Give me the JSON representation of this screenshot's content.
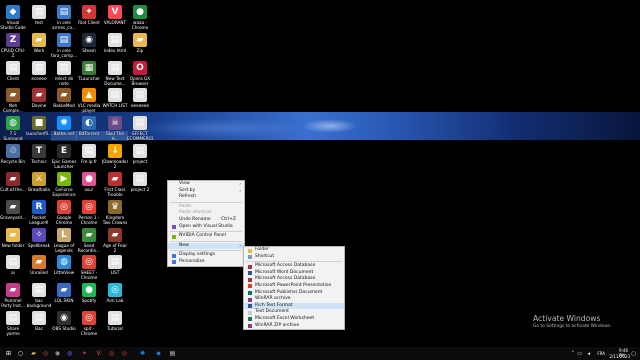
{
  "desktop": {
    "icons": [
      {
        "label": "Visual Studio Code",
        "glyph": "◆",
        "color": "#2b7acb",
        "col": 0,
        "row": 0
      },
      {
        "label": "test",
        "glyph": "▤",
        "color": "#e0e0e0",
        "col": 1,
        "row": 0
      },
      {
        "label": "in cele armes_co...",
        "glyph": "▤",
        "color": "#3c78c8",
        "col": 2,
        "row": 0
      },
      {
        "label": "Riot Client",
        "glyph": "✦",
        "color": "#d13639",
        "col": 3,
        "row": 0
      },
      {
        "label": "VALORANT",
        "glyph": "V",
        "color": "#ff4655",
        "col": 4,
        "row": 0
      },
      {
        "label": "waaa - Chrome",
        "glyph": "●",
        "color": "#1e8e3e",
        "col": 5,
        "row": 0
      },
      {
        "label": "CPUID CPU-Z",
        "glyph": "Z",
        "color": "#5a3c91",
        "col": 0,
        "row": 1
      },
      {
        "label": "Work",
        "glyph": "▰",
        "color": "#e8b84b",
        "col": 1,
        "row": 1
      },
      {
        "label": "in cele fara_comp...",
        "glyph": "▤",
        "color": "#3c78c8",
        "col": 2,
        "row": 1
      },
      {
        "label": "Steam",
        "glyph": "◉",
        "color": "#1b2838",
        "col": 3,
        "row": 1
      },
      {
        "label": "index.html",
        "glyph": "▤",
        "color": "#e0e0e0",
        "col": 4,
        "row": 1
      },
      {
        "label": "Zip",
        "glyph": "▰",
        "color": "#e8b84b",
        "col": 5,
        "row": 1
      },
      {
        "label": "Client",
        "glyph": "▤",
        "color": "#e0e0e0",
        "col": 0,
        "row": 2
      },
      {
        "label": "eceeeo",
        "glyph": "▤",
        "color": "#e0e0e0",
        "col": 1,
        "row": 2
      },
      {
        "label": "relect de note",
        "glyph": "▤",
        "color": "#e0e0e0",
        "col": 2,
        "row": 2
      },
      {
        "label": "TLauncher",
        "glyph": "▦",
        "color": "#3a7b3a",
        "col": 3,
        "row": 2
      },
      {
        "label": "New Text Docume...",
        "glyph": "▤",
        "color": "#e0e0e0",
        "col": 4,
        "row": 2
      },
      {
        "label": "Opera GX Browser",
        "glyph": "O",
        "color": "#c41a3b",
        "col": 5,
        "row": 2
      },
      {
        "label": "Noh Comple...",
        "glyph": "▰",
        "color": "#8a5a2b",
        "col": 0,
        "row": 3
      },
      {
        "label": "Devine",
        "glyph": "▰",
        "color": "#a03232",
        "col": 1,
        "row": 3
      },
      {
        "label": "BakkeMod",
        "glyph": "▰",
        "color": "#8a5a2b",
        "col": 2,
        "row": 3
      },
      {
        "label": "VLC media player",
        "glyph": "▲",
        "color": "#f08a00",
        "col": 3,
        "row": 3
      },
      {
        "label": "WATCH LIST",
        "glyph": "▤",
        "color": "#e0e0e0",
        "col": 4,
        "row": 3
      },
      {
        "label": "eeeeeee",
        "glyph": "▤",
        "color": "#e0e0e0",
        "col": 5,
        "row": 3
      },
      {
        "label": "7.1 Surround Sound",
        "glyph": "◍",
        "color": "#2ea04a",
        "col": 0,
        "row": 4
      },
      {
        "label": "launcherfil...",
        "glyph": "■",
        "color": "#6b6b2b",
        "col": 1,
        "row": 4
      },
      {
        "label": "Battle.net",
        "glyph": "✺",
        "color": "#148eff",
        "col": 2,
        "row": 4
      },
      {
        "label": "BitTorrent",
        "glyph": "◐",
        "color": "#2a6ab3",
        "col": 3,
        "row": 4
      },
      {
        "label": "Skul The H...",
        "glyph": "☠",
        "color": "#6a4a8a",
        "col": 4,
        "row": 4
      },
      {
        "label": "EFFECT ECOMMERCE",
        "glyph": "▤",
        "color": "#e0e0e0",
        "col": 5,
        "row": 4
      },
      {
        "label": "Recycle Bin",
        "glyph": "♲",
        "color": "#4a6fa5",
        "col": 0,
        "row": 5
      },
      {
        "label": "Technic",
        "glyph": "T",
        "color": "#3a3a3a",
        "col": 1,
        "row": 5
      },
      {
        "label": "Epic Games Launcher",
        "glyph": "E",
        "color": "#2a2a2a",
        "col": 2,
        "row": 5
      },
      {
        "label": "Fre:ip fr",
        "glyph": "▤",
        "color": "#e0e0e0",
        "col": 3,
        "row": 5
      },
      {
        "label": "JDownloader 2",
        "glyph": "↓",
        "color": "#f4a400",
        "col": 4,
        "row": 5
      },
      {
        "label": "project",
        "glyph": "▤",
        "color": "#e0e0e0",
        "col": 5,
        "row": 5
      },
      {
        "label": "Cult.of.the...",
        "glyph": "▰",
        "color": "#8a2b2b",
        "col": 0,
        "row": 6
      },
      {
        "label": "Brawlhalla",
        "glyph": "⚔",
        "color": "#c8a02b",
        "col": 1,
        "row": 6
      },
      {
        "label": "GeForce Experience",
        "glyph": "▶",
        "color": "#76b900",
        "col": 2,
        "row": 6
      },
      {
        "label": "osu!",
        "glyph": "●",
        "color": "#e05398",
        "col": 3,
        "row": 6
      },
      {
        "label": "First Class Trouble",
        "glyph": "▰",
        "color": "#b83232",
        "col": 4,
        "row": 6
      },
      {
        "label": "project 2",
        "glyph": "▤",
        "color": "#e0e0e0",
        "col": 5,
        "row": 6
      },
      {
        "label": "Graveyard...",
        "glyph": "▰",
        "color": "#4a4a4a",
        "col": 0,
        "row": 7
      },
      {
        "label": "Rocket League®",
        "glyph": "R",
        "color": "#1e5ac8",
        "col": 1,
        "row": 7
      },
      {
        "label": "Google Chrome",
        "glyph": "◎",
        "color": "#db4437",
        "col": 2,
        "row": 7
      },
      {
        "label": "Person 1 - Chrome",
        "glyph": "◎",
        "color": "#db4437",
        "col": 3,
        "row": 7
      },
      {
        "label": "Kingdom Two Crowns",
        "glyph": "♛",
        "color": "#8a6a2b",
        "col": 4,
        "row": 7
      },
      {
        "label": "New folder",
        "glyph": "▰",
        "color": "#e8b84b",
        "col": 0,
        "row": 8
      },
      {
        "label": "Spellbreak",
        "glyph": "✧",
        "color": "#5a4ab8",
        "col": 1,
        "row": 8
      },
      {
        "label": "League of Legends",
        "glyph": "L",
        "color": "#c8aa6e",
        "col": 2,
        "row": 8
      },
      {
        "label": "Seed Recordin...",
        "glyph": "▰",
        "color": "#3a8a3a",
        "col": 3,
        "row": 8
      },
      {
        "label": "Age of Fear 2",
        "glyph": "▰",
        "color": "#8a3a2b",
        "col": 4,
        "row": 8
      },
      {
        "label": "ai",
        "glyph": "▤",
        "color": "#e0e0e0",
        "col": 0,
        "row": 9
      },
      {
        "label": "Unrailed",
        "glyph": "▰",
        "color": "#d87a2b",
        "col": 1,
        "row": 9
      },
      {
        "label": "LittleView",
        "glyph": "◍",
        "color": "#2b8ad8",
        "col": 2,
        "row": 9
      },
      {
        "label": "SHEET - Chrome",
        "glyph": "◎",
        "color": "#db4437",
        "col": 3,
        "row": 9
      },
      {
        "label": "LIST",
        "glyph": "▤",
        "color": "#e0e0e0",
        "col": 4,
        "row": 9
      },
      {
        "label": "Pummel Party Inst...",
        "glyph": "▰",
        "color": "#c83a8a",
        "col": 0,
        "row": 10
      },
      {
        "label": "bac background",
        "glyph": "▤",
        "color": "#e0e0e0",
        "col": 1,
        "row": 10
      },
      {
        "label": "LOL SKIN",
        "glyph": "▰",
        "color": "#3a6ac8",
        "col": 2,
        "row": 10
      },
      {
        "label": "Spotify",
        "glyph": "●",
        "color": "#1db954",
        "col": 3,
        "row": 10
      },
      {
        "label": "Aim Lab",
        "glyph": "◎",
        "color": "#2bb8d8",
        "col": 4,
        "row": 10
      },
      {
        "label": "Share yorme",
        "glyph": "▤",
        "color": "#e0e0e0",
        "col": 0,
        "row": 11
      },
      {
        "label": "Bac",
        "glyph": "▤",
        "color": "#e0e0e0",
        "col": 1,
        "row": 11
      },
      {
        "label": "OBS Studio",
        "glyph": "◉",
        "color": "#302e31",
        "col": 2,
        "row": 11
      },
      {
        "label": "spit - Chrome",
        "glyph": "◎",
        "color": "#db4437",
        "col": 3,
        "row": 11
      },
      {
        "label": "Tutorial",
        "glyph": "▤",
        "color": "#e0e0e0",
        "col": 4,
        "row": 11
      }
    ]
  },
  "context_menu": {
    "items": [
      {
        "type": "item",
        "label": "View",
        "arrow": "›"
      },
      {
        "type": "item",
        "label": "Sort by",
        "arrow": "›"
      },
      {
        "type": "item",
        "label": "Refresh"
      },
      {
        "type": "sep"
      },
      {
        "type": "item",
        "label": "Paste",
        "disabled": true
      },
      {
        "type": "item",
        "label": "Paste shortcut",
        "disabled": true
      },
      {
        "type": "item",
        "label": "Undo Rename",
        "shortcut": "Ctrl+Z"
      },
      {
        "type": "item",
        "label": "Open with Visual Studio",
        "icon": "#7a4fc4"
      },
      {
        "type": "sep"
      },
      {
        "type": "item",
        "label": "NVIDIA Control Panel",
        "icon": "#76b900"
      },
      {
        "type": "sep"
      },
      {
        "type": "item",
        "label": "New",
        "arrow": "›",
        "highlight": true
      },
      {
        "type": "sep"
      },
      {
        "type": "item",
        "label": "Display settings",
        "icon": "#3a7bd5"
      },
      {
        "type": "item",
        "label": "Personalize",
        "icon": "#3a7bd5"
      }
    ]
  },
  "new_submenu": {
    "items": [
      {
        "type": "item",
        "label": "Folder",
        "icon": "#e8b84b"
      },
      {
        "type": "item",
        "label": "Shortcut",
        "icon": "#7a9ac8"
      },
      {
        "type": "sep"
      },
      {
        "type": "item",
        "label": "Microsoft Access Database",
        "icon": "#a4373a"
      },
      {
        "type": "item",
        "label": "Microsoft Word Document",
        "icon": "#2b579a"
      },
      {
        "type": "item",
        "label": "Microsoft Access Database",
        "icon": "#a4373a"
      },
      {
        "type": "item",
        "label": "Microsoft PowerPoint Presentation",
        "icon": "#d24726"
      },
      {
        "type": "item",
        "label": "Microsoft Publisher Document",
        "icon": "#077568"
      },
      {
        "type": "item",
        "label": "WinRAR archive",
        "icon": "#8a3a8a"
      },
      {
        "type": "item",
        "label": "Rich Text Format",
        "icon": "#2b579a",
        "highlight": true
      },
      {
        "type": "item",
        "label": "Text Document",
        "icon": "#c8c8c8"
      },
      {
        "type": "item",
        "label": "Microsoft Excel Worksheet",
        "icon": "#217346"
      },
      {
        "type": "item",
        "label": "WinRAR ZIP archive",
        "icon": "#8a3a8a"
      }
    ]
  },
  "watermark": {
    "title": "Activate Windows",
    "subtitle": "Go to Settings to activate Windows."
  },
  "taskbar": {
    "apps": [
      {
        "name": "start-button",
        "glyph": "⊞",
        "color": "#ffffff"
      },
      {
        "name": "search-icon",
        "glyph": "○",
        "color": "#ffffff"
      },
      {
        "name": "file-explorer-icon",
        "glyph": "▰",
        "color": "#e8b84b"
      },
      {
        "name": "chrome-icon",
        "glyph": "◎",
        "color": "#db4437"
      },
      {
        "name": "steam-icon",
        "glyph": "◉",
        "color": "#9ab"
      },
      {
        "name": "discord-icon",
        "glyph": "◍",
        "color": "#5865f2"
      },
      {
        "name": "riot-icon",
        "glyph": "✦",
        "color": "#d13639"
      },
      {
        "name": "valorant-icon",
        "glyph": "V",
        "color": "#ff4655"
      },
      {
        "name": "chrome-icon-2",
        "glyph": "◎",
        "color": "#db4437"
      },
      {
        "name": "chrome-icon-3",
        "glyph": "◎",
        "color": "#db4437"
      },
      {
        "name": "battlenet-icon",
        "glyph": "✺",
        "color": "#148eff"
      },
      {
        "name": "vscode-icon",
        "glyph": "◆",
        "color": "#2b7acb"
      },
      {
        "name": "notepad-icon",
        "glyph": "▤",
        "color": "#cfd8dc"
      }
    ],
    "lang": "FRA",
    "time": "9:46 PM",
    "date": "2/11/2023"
  }
}
